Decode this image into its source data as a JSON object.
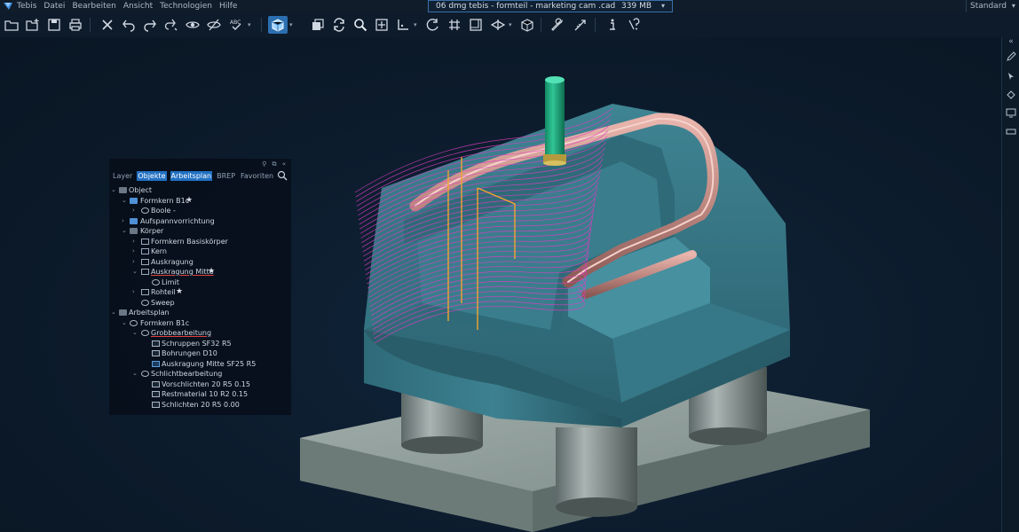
{
  "menubar": {
    "items": [
      "Tebis",
      "Datei",
      "Bearbeiten",
      "Ansicht",
      "Technologien",
      "Hilfe"
    ],
    "title": "06 dmg tebis - formteil - marketing cam .cad",
    "memory": "339 MB",
    "window_count": "1",
    "profile": "Standard"
  },
  "toolbar": {
    "icons": [
      "open-folder-icon",
      "new-folder-icon",
      "save-icon",
      "print-icon",
      "delete-icon",
      "undo-icon",
      "redo-icon",
      "show-icon",
      "hide-icon",
      "spellcheck-icon",
      "view-cube-icon",
      "layers-icon",
      "regenerate-icon",
      "zoom-icon",
      "fit-icon",
      "axis-icon",
      "rotate-icon",
      "grid-icon",
      "frame-icon",
      "section-icon",
      "box-icon",
      "wrench-icon",
      "measure-icon",
      "info-icon",
      "help-icon"
    ]
  },
  "tree": {
    "tabs": [
      "Layer",
      "Objekte",
      "Arbeitsplan",
      "BREP",
      "Favoriten"
    ],
    "selected_tabs": [
      "Objekte",
      "Arbeitsplan"
    ],
    "rows": [
      {
        "label": "Object"
      },
      {
        "label": "Formkern B1c"
      },
      {
        "label": "Boole -"
      },
      {
        "label": "Aufspannvorrichtung"
      },
      {
        "label": "Körper"
      },
      {
        "label": "Formkern Basiskörper"
      },
      {
        "label": "Kern"
      },
      {
        "label": "Auskragung"
      },
      {
        "label": "Auskragung Mitte"
      },
      {
        "label": "Limit"
      },
      {
        "label": "Rohteil"
      },
      {
        "label": "Sweep"
      },
      {
        "label": "Arbeitsplan"
      },
      {
        "label": "Formkern B1c"
      },
      {
        "label": "Grobbearbeitung"
      },
      {
        "label": "Schruppen SF32 R5"
      },
      {
        "label": "Bohrungen D10"
      },
      {
        "label": "Auskragung Mitte SF25 R5"
      },
      {
        "label": "Schlichtbearbeitung"
      },
      {
        "label": "Vorschlichten 20 R5 0.15"
      },
      {
        "label": "Restmaterial 10 R2 0.15"
      },
      {
        "label": "Schlichten 20 R5 0.00"
      }
    ]
  },
  "colors": {
    "background": "#0b1928",
    "accent": "#2c6fb0",
    "part": "#3e8696",
    "toolpath": "#e23cc4",
    "tool": "#1ea37a"
  }
}
